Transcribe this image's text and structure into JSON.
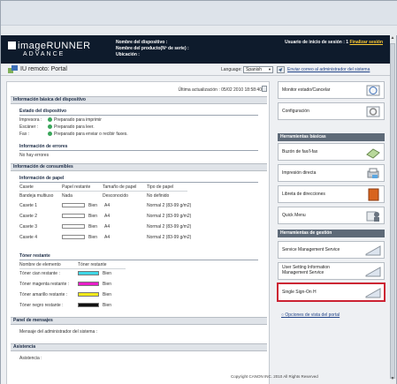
{
  "browser": {
    "address_value": ""
  },
  "header": {
    "logo_line1": "imageRUNNER",
    "logo_line2": "ADVANCE",
    "device_name_label": "Nombre del dispositivo :",
    "product_name_label": "Nombre del producto(Nº de serie) :",
    "location_label": "Ubicación :",
    "login_user_label": "Usuario de inicio de sesión : 1",
    "logout_link": "Finalizar sesión"
  },
  "nav": {
    "title": "IU remoto: Portal",
    "language_label": "Language:",
    "language_value": "Spanish",
    "mail_link": "Enviar correo al administrador del sistema"
  },
  "status": {
    "last_update": "Última actualización : 05/02 2010 18:58:40",
    "basic_info_title": "Información básica del dispositivo",
    "device_status_title": "Estado del dispositivo",
    "device_rows": [
      {
        "label": "Impresora :",
        "value": "Preparado para imprimir"
      },
      {
        "label": "Escáner :",
        "value": "Preparado para leer."
      },
      {
        "label": "Fax :",
        "value": "Preparado para enviar o recibir faxes."
      }
    ],
    "errors_title": "Información de errores",
    "errors_value": "No hay errores",
    "consumables_title": "Información de consumibles",
    "paper_title": "Información de papel",
    "paper_headers": [
      "Casete",
      "Papel restante",
      "Tamaño de papel",
      "Tipo de papel"
    ],
    "paper_rows": [
      {
        "source": "Bandeja multiuso",
        "remaining": "Nada",
        "size": "Desconocido",
        "type": "No definido",
        "level": null
      },
      {
        "source": "Casete 1",
        "remaining": "Bien",
        "size": "A4",
        "type": "Normal 2 (83-99 g/m2)",
        "level": 0
      },
      {
        "source": "Casete 2",
        "remaining": "Bien",
        "size": "A4",
        "type": "Normal 2 (83-99 g/m2)",
        "level": 0
      },
      {
        "source": "Casete 3",
        "remaining": "Bien",
        "size": "A4",
        "type": "Normal 2 (83-99 g/m2)",
        "level": 0
      },
      {
        "source": "Casete 4",
        "remaining": "Bien",
        "size": "A4",
        "type": "Normal 2 (83-99 g/m2)",
        "level": 0
      }
    ],
    "toner_title": "Tóner restante",
    "toner_headers": [
      "Nombre de elemento",
      "Tóner restante"
    ],
    "toner_rows": [
      {
        "label": "Tóner cian restante :",
        "value": "Bien",
        "color": "#3fd6e6"
      },
      {
        "label": "Tóner magenta restante :",
        "value": "Bien",
        "color": "#e81fc8"
      },
      {
        "label": "Tóner amarillo restante :",
        "value": "Bien",
        "color": "#f2ea1a"
      },
      {
        "label": "Tóner negro restante :",
        "value": "Bien",
        "color": "#111111"
      }
    ],
    "messages_title": "Panel de mensajes",
    "messages_value": "Mensaje del administrador del sistema :",
    "assist_title": "Asistencia",
    "assist_value": "Asistencia :"
  },
  "right": {
    "monitor_label": "Monitor estado/Cancelar",
    "settings_label": "Configuración",
    "basic_tools_title": "Herramientas básicas",
    "basic_tools": [
      "Buzón de fax/I-fax",
      "Impresión directa",
      "Libreta de direcciones",
      "Quick Menu"
    ],
    "mgmt_tools_title": "Herramientas de gestión",
    "mgmt_tools": [
      "Service Management Service",
      "User Setting Information\nManagement Service",
      "Single Sign-On H"
    ],
    "portal_options_link": "Opciones de vista del portal"
  },
  "footer": {
    "copyright": "Copyright CANON INC. 2010 All Rights Reserved"
  }
}
